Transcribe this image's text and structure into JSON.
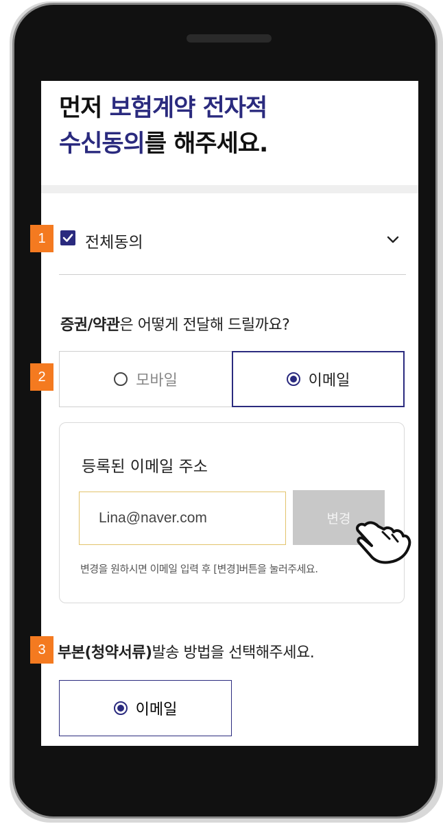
{
  "title": {
    "line1_plain": "먼저 ",
    "line1_highlight": "보험계약 전자적",
    "line2_highlight": "수신동의",
    "line2_plain": "를 해주세요."
  },
  "agree_all": {
    "label": "전체동의",
    "checked": true
  },
  "delivery_question": {
    "bold": "증권/약관",
    "rest": "은 어떻게 전달해 드릴까요?"
  },
  "delivery_options": [
    {
      "label": "모바일",
      "selected": false
    },
    {
      "label": "이메일",
      "selected": true
    }
  ],
  "email_section": {
    "title": "등록된 이메일 주소",
    "email_value": "Lina@naver.com",
    "change_button": "변경",
    "hint": "변경을 원하시면 이메일 입력 후 [변경]버튼을 눌러주세요."
  },
  "copy_question": {
    "bold": "부본(청약서류)",
    "rest": "발송 방법을 선택해주세요."
  },
  "copy_options": [
    {
      "label": "이메일",
      "selected": true
    }
  ],
  "step_badges": [
    "1",
    "2",
    "3"
  ],
  "colors": {
    "accent": "#2a2a7e",
    "badge": "#f47a20",
    "input_border": "#e2c36a",
    "disabled_button": "#c8c8c8"
  },
  "icons": {
    "check": "checkmark-icon",
    "chevron": "chevron-down-icon",
    "pointer": "hand-pointer-icon"
  }
}
